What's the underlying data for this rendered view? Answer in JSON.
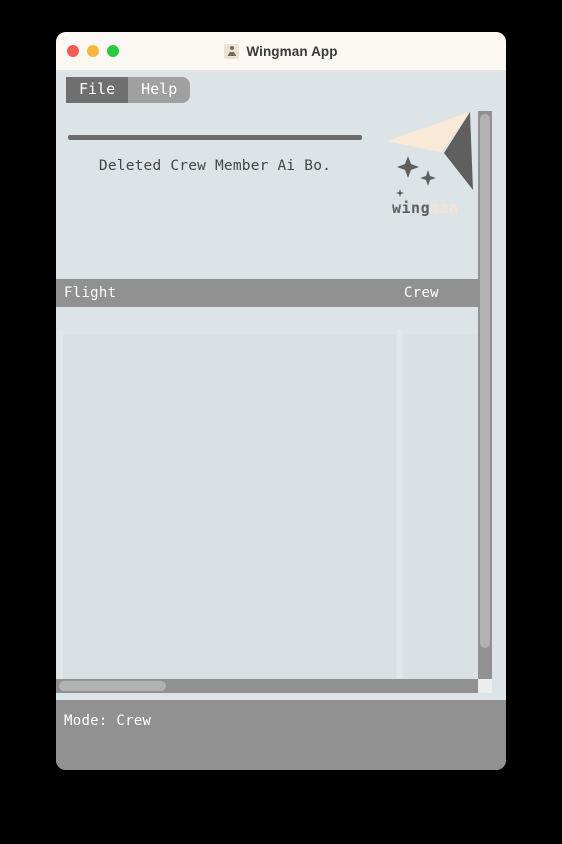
{
  "window": {
    "title": "Wingman App",
    "app_icon": "person-badge-icon",
    "traffic_lights": [
      {
        "name": "close-button",
        "color": "#f65c53"
      },
      {
        "name": "minimize-button",
        "color": "#f6b73c"
      },
      {
        "name": "maximize-button",
        "color": "#2ac940"
      }
    ]
  },
  "menubar": {
    "items": [
      {
        "label": "File",
        "state": "active"
      },
      {
        "label": "Help",
        "state": "inactive"
      }
    ]
  },
  "banner": {
    "message": "Deleted Crew Member Ai Bo.",
    "logo": {
      "wordmark_part1": "wing",
      "wordmark_part2": "man",
      "plane_light_color": "#fbe9d7",
      "plane_dark_color": "#5f5f5f",
      "sparkle_color": "#5f5f5f"
    }
  },
  "table": {
    "columns": [
      "Flight",
      "Crew"
    ],
    "rows": []
  },
  "scrollbars": {
    "vertical": {
      "name": "vertical-scrollbar"
    },
    "horizontal": {
      "name": "horizontal-scrollbar"
    }
  },
  "statusbar": {
    "text": "Mode: Crew"
  },
  "colors": {
    "window_background": "#dde4e7",
    "titlebar_background": "#fbf8f4",
    "header_gray": "#919191",
    "menu_active": "#6f6f6f",
    "menu_inactive": "#a0a0a0",
    "pane_background": "#dae1e4"
  }
}
